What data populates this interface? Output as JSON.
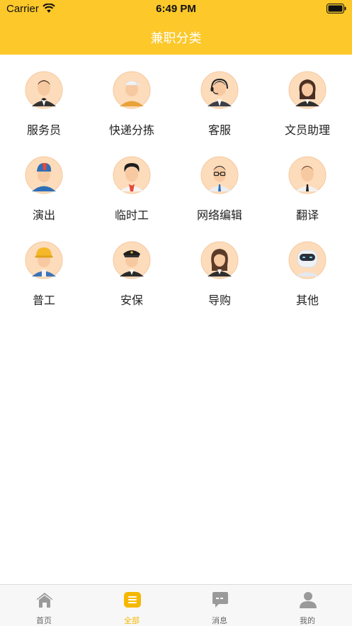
{
  "status_bar": {
    "carrier": "Carrier",
    "time": "6:49 PM"
  },
  "header": {
    "title": "兼职分类"
  },
  "categories": [
    {
      "label": "服务员",
      "icon": "waiter-avatar-icon"
    },
    {
      "label": "快递分拣",
      "icon": "courier-avatar-icon"
    },
    {
      "label": "客服",
      "icon": "customer-service-avatar-icon"
    },
    {
      "label": "文员助理",
      "icon": "clerk-avatar-icon"
    },
    {
      "label": "演出",
      "icon": "performer-avatar-icon"
    },
    {
      "label": "临时工",
      "icon": "temp-worker-avatar-icon"
    },
    {
      "label": "网络编辑",
      "icon": "editor-avatar-icon"
    },
    {
      "label": "翻译",
      "icon": "translator-avatar-icon"
    },
    {
      "label": "普工",
      "icon": "worker-avatar-icon"
    },
    {
      "label": "安保",
      "icon": "security-avatar-icon"
    },
    {
      "label": "导购",
      "icon": "shopping-guide-avatar-icon"
    },
    {
      "label": "其他",
      "icon": "robot-avatar-icon"
    }
  ],
  "tabbar": {
    "active": "全部",
    "items": [
      {
        "label": "首页",
        "icon": "home-icon"
      },
      {
        "label": "全部",
        "icon": "list-icon"
      },
      {
        "label": "消息",
        "icon": "message-icon"
      },
      {
        "label": "我的",
        "icon": "person-icon"
      }
    ]
  },
  "colors": {
    "accent": "#FCC82A",
    "active_tab": "#F5B800",
    "avatar_bg": "#FDDCBB",
    "inactive_icon": "#9a9a9a"
  }
}
